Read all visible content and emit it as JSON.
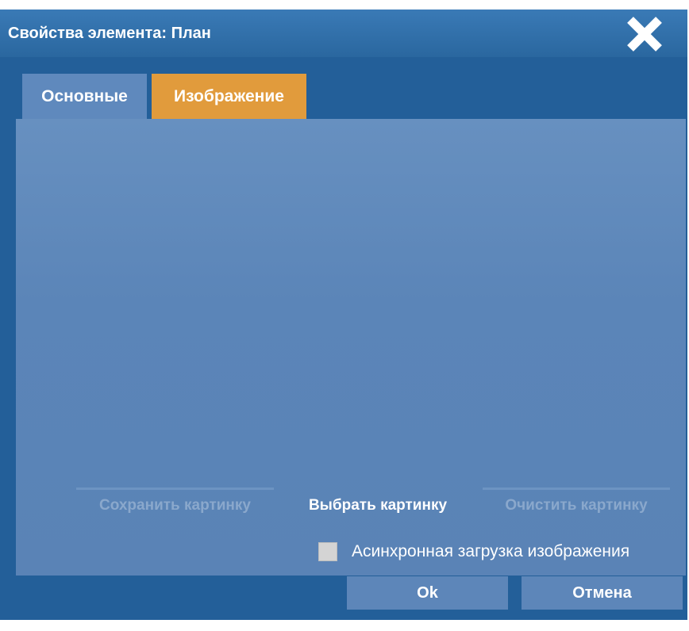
{
  "dialog": {
    "title": "Свойства элемента: План",
    "close_icon": "close-icon"
  },
  "tabs": [
    {
      "label": "Основные",
      "active": false
    },
    {
      "label": "Изображение",
      "active": true
    }
  ],
  "image_panel": {
    "save_label": "Сохранить картинку",
    "save_enabled": false,
    "pick_label": "Выбрать картинку",
    "pick_enabled": true,
    "clear_label": "Очистить картинку",
    "clear_enabled": false,
    "async_label": "Асинхронная загрузка изображения",
    "async_checked": false
  },
  "footer": {
    "ok_label": "Ok",
    "cancel_label": "Отмена"
  },
  "colors": {
    "dialog_bg": "#235f99",
    "tab_active": "#e19b3c",
    "tab_inactive": "#5f89bd",
    "panel_bg": "#5a83b6"
  }
}
